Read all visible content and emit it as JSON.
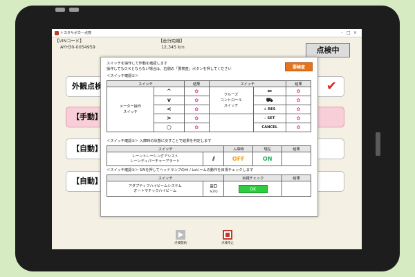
{
  "window_title": "トヨタサポカー点検",
  "info": {
    "vin_label": "【VINコード】",
    "vin_value": "AYH30-0054959",
    "mileage_label": "【走行距離】",
    "mileage_value": "12,345 km"
  },
  "status": "点検中",
  "list_items": [
    {
      "label": "外観点検",
      "checked": true
    },
    {
      "label": "【手動】"
    },
    {
      "label": "【自動】"
    },
    {
      "label": "【自動】"
    }
  ],
  "bottom_bar": {
    "start_label": "点検開始",
    "stop_label": "点検停止"
  },
  "dialog": {
    "instruction1": "スイッチを操作して作動を確認します",
    "instruction2": "操作してもＯＫとならない場合は、右側の「要検査」ボタンを押してください",
    "request_button": "要検査",
    "section1_title": "＜スイッチ確認①＞",
    "table1": {
      "headers": [
        "スイッチ",
        "結果",
        "スイッチ",
        "結果"
      ],
      "left_group_line1": "メーター操作",
      "left_group_line2": "スイッチ",
      "left_symbols": [
        "^",
        "v",
        "<",
        ">",
        "○"
      ],
      "right_group_line1": "クルーズ",
      "right_group_line2": "コントロール",
      "right_group_line3": "スイッチ",
      "right_buttons": [
        "+ RES",
        "– SET",
        "CANCEL"
      ]
    },
    "section2_title": "＜スイッチ確認②＞ 入庫時の状態に戻すことで結果を判定します",
    "table2": {
      "headers": [
        "スイッチ",
        "入庫時",
        "現在",
        "結果"
      ],
      "row_label_line1": "レーントレーシングアシスト",
      "row_label_line2": "レーンディパーチャーアラート",
      "entry_value": "OFF",
      "current_value": "ON"
    },
    "section3_title": "＜スイッチ確認③＞ SWを押してヘッドランプのHi / Loビームの動作を目視チェックします",
    "table3": {
      "headers": [
        "スイッチ",
        "目視チェック",
        "結果"
      ],
      "row_label_line1": "アダプティブハイビームシステム",
      "row_label_line2": "オートマチックハイビーム",
      "icon_label": "AUTO",
      "ok_label": "OK"
    }
  },
  "colors": {
    "background": "#d7ebc3",
    "tablet": "#1d1d1d",
    "accent_orange": "#e6731c",
    "ok_green": "#2ecc40",
    "check_red": "#d22222"
  }
}
